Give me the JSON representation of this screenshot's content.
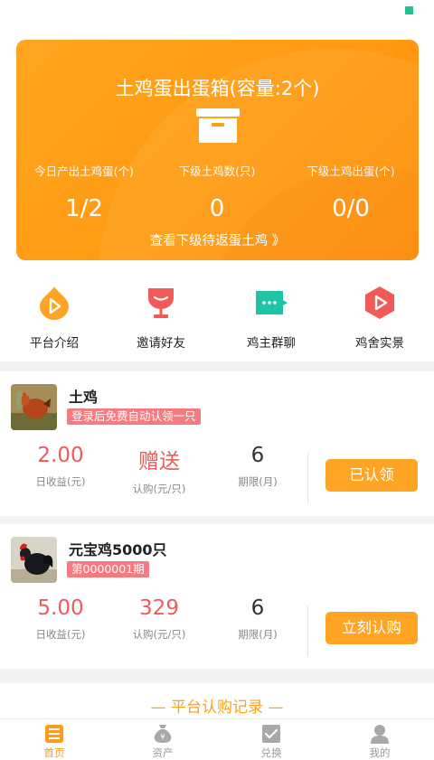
{
  "egg_box": {
    "title": "土鸡蛋出蛋箱(容量:2个)",
    "stats": [
      {
        "label": "今日产出土鸡蛋(个)",
        "value": "1/2"
      },
      {
        "label": "下级土鸡数(只)",
        "value": "0"
      },
      {
        "label": "下级土鸡出蛋(个)",
        "value": "0/0"
      }
    ],
    "link": "查看下级待返蛋土鸡 》"
  },
  "nav": [
    {
      "label": "平台介绍",
      "icon": "orange-drop-play-icon",
      "color": "#ffa423"
    },
    {
      "label": "邀请好友",
      "icon": "red-cup-icon",
      "color": "#f25a5a"
    },
    {
      "label": "鸡主群聊",
      "icon": "chat-bubble-icon",
      "color": "#1fc3a6"
    },
    {
      "label": "鸡舍实景",
      "icon": "red-hexagon-play-icon",
      "color": "#f25a5a"
    }
  ],
  "products": [
    {
      "name": "土鸡",
      "tag": "登录后免费自动认领一只",
      "thumb": "hen-photo",
      "metrics": [
        {
          "value": "2.00",
          "label": "日收益(元)"
        },
        {
          "value": "赠送",
          "label": "认购(元/只)"
        },
        {
          "value": "6",
          "label": "期限(月)"
        }
      ],
      "button": "已认领"
    },
    {
      "name": "元宝鸡5000只",
      "tag": "第0000001期",
      "thumb": "rooster-photo",
      "metrics": [
        {
          "value": "5.00",
          "label": "日收益(元)"
        },
        {
          "value": "329",
          "label": "认购(元/只)"
        },
        {
          "value": "6",
          "label": "期限(月)"
        }
      ],
      "button": "立刻认购"
    }
  ],
  "records_title": "— 平台认购记录 —",
  "tabs": [
    {
      "label": "首页",
      "icon": "home-icon",
      "active": true
    },
    {
      "label": "资产",
      "icon": "money-bag-icon",
      "active": false
    },
    {
      "label": "兑换",
      "icon": "exchange-check-icon",
      "active": false
    },
    {
      "label": "我的",
      "icon": "user-icon",
      "active": false
    }
  ],
  "colors": {
    "accent": "#ffa423",
    "red": "#ef5b5b",
    "teal": "#1fc3a6"
  }
}
